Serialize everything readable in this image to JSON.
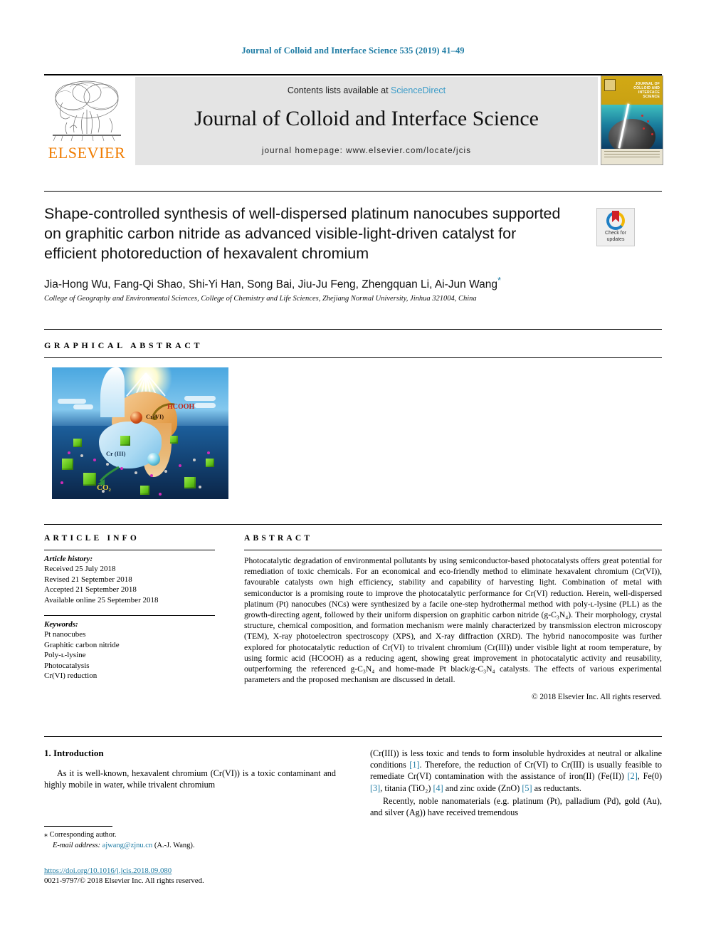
{
  "running_head": "Journal of Colloid and Interface Science 535 (2019) 41–49",
  "masthead": {
    "contents_prefix": "Contents lists available at ",
    "sciencedirect": "ScienceDirect",
    "journal_name": "Journal of Colloid and Interface Science",
    "homepage": "journal homepage: www.elsevier.com/locate/jcis",
    "publisher": "ELSEVIER",
    "cover_title": "JOURNAL OF COLLOID AND INTERFACE SCIENCE"
  },
  "article": {
    "title": "Shape-controlled synthesis of well-dispersed platinum nanocubes supported on graphitic carbon nitride as advanced visible-light-driven catalyst for efficient photoreduction of hexavalent chromium",
    "authors": "Jia-Hong Wu, Fang-Qi Shao, Shi-Yi Han, Song Bai, Jiu-Ju Feng, Zhengquan Li, Ai-Jun Wang",
    "author_star": "*",
    "affiliation": "College of Geography and Environmental Sciences, College of Chemistry and Life Sciences, Zhejiang Normal University, Jinhua 321004, China"
  },
  "crossmark": {
    "line1": "Check for",
    "line2": "updates"
  },
  "graphical_abstract": {
    "heading": "GRAPHICAL ABSTRACT",
    "labels": {
      "hcooh": "HCOOH",
      "cr6": "Cr(VI)",
      "cr3": "Cr (III)",
      "co2": "CO₂"
    }
  },
  "article_info": {
    "heading": "ARTICLE INFO",
    "history_label": "Article history:",
    "history": [
      "Received 25 July 2018",
      "Revised 21 September 2018",
      "Accepted 21 September 2018",
      "Available online 25 September 2018"
    ],
    "keywords_label": "Keywords:",
    "keywords": [
      "Pt nanocubes",
      "Graphitic carbon nitride",
      "Poly-ʟ-lysine",
      "Photocatalysis",
      "Cr(VI) reduction"
    ]
  },
  "abstract": {
    "heading": "ABSTRACT",
    "text": "Photocatalytic degradation of environmental pollutants by using semiconductor-based photocatalysts offers great potential for remediation of toxic chemicals. For an economical and eco-friendly method to eliminate hexavalent chromium (Cr(VI)), favourable catalysts own high efficiency, stability and capability of harvesting light. Combination of metal with semiconductor is a promising route to improve the photocatalytic performance for Cr(VI) reduction. Herein, well-dispersed platinum (Pt) nanocubes (NCs) were synthesized by a facile one-step hydrothermal method with poly-ʟ-lysine (PLL) as the growth-directing agent, followed by their uniform dispersion on graphitic carbon nitride (g-C₃N₄). Their morphology, crystal structure, chemical composition, and formation mechanism were mainly characterized by transmission electron microscopy (TEM), X-ray photoelectron spectroscopy (XPS), and X-ray diffraction (XRD). The hybrid nanocomposite was further explored for photocatalytic reduction of Cr(VI) to trivalent chromium (Cr(III)) under visible light at room temperature, by using formic acid (HCOOH) as a reducing agent, showing great improvement in photocatalytic activity and reusability, outperforming the referenced g-C₃N₄ and home-made Pt black/g-C₃N₄ catalysts. The effects of various experimental parameters and the proposed mechanism are discussed in detail.",
    "copyright": "© 2018 Elsevier Inc. All rights reserved."
  },
  "body": {
    "section_heading": "1. Introduction",
    "left_para": "As it is well-known, hexavalent chromium (Cr(VI)) is a toxic contaminant and highly mobile in water, while trivalent chromium",
    "right_para_1_a": "(Cr(III)) is less toxic and tends to form insoluble hydroxides at neutral or alkaline conditions ",
    "right_para_1_ref1": "[1]",
    "right_para_1_b": ". Therefore, the reduction of Cr(VI) to Cr(III) is usually feasible to remediate Cr(VI) contamination with the assistance of iron(II) (Fe(II)) ",
    "right_para_1_ref2": "[2]",
    "right_para_1_c": ", Fe(0) ",
    "right_para_1_ref3": "[3]",
    "right_para_1_d": ", titania (TiO₂) ",
    "right_para_1_ref4": "[4]",
    "right_para_1_e": " and zinc oxide (ZnO) ",
    "right_para_1_ref5": "[5]",
    "right_para_1_f": " as reductants.",
    "right_para_2": "Recently, noble nanomaterials (e.g. platinum (Pt), palladium (Pd), gold (Au), and silver (Ag)) have received tremendous"
  },
  "footer": {
    "corresponding_star": "⁎",
    "corresponding_label": "Corresponding author.",
    "email_label": "E-mail address:",
    "email": "ajwang@zjnu.cn",
    "email_suffix": "(A.-J. Wang).",
    "doi": "https://doi.org/10.1016/j.jcis.2018.09.080",
    "issn_line": "0021-9797/© 2018 Elsevier Inc. All rights reserved."
  },
  "colors": {
    "link": "#1f7ca4",
    "elsevier_orange": "#f07c00",
    "sciencedirect": "#3a9bc8"
  }
}
